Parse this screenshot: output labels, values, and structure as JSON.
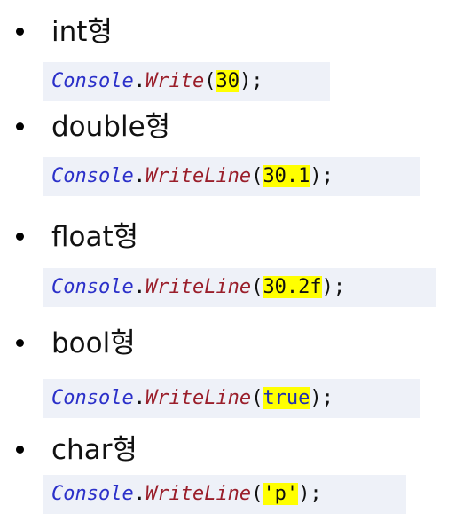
{
  "items": [
    {
      "type": "int형",
      "cls": "Console",
      "dot": ".",
      "method": "Write",
      "open": "(",
      "arg": "30",
      "close": ");"
    },
    {
      "type": "double형",
      "cls": "Console",
      "dot": ".",
      "method": "WriteLine",
      "open": "(",
      "arg": "30.1",
      "close": ");"
    },
    {
      "type": "float형",
      "cls": "Console",
      "dot": ".",
      "method": "WriteLine",
      "open": "(",
      "arg": "30.2f",
      "close": ");"
    },
    {
      "type": "bool형",
      "cls": "Console",
      "dot": ".",
      "method": "WriteLine",
      "open": "(",
      "arg": "true",
      "close": ");"
    },
    {
      "type": "char형",
      "cls": "Console",
      "dot": ".",
      "method": "WriteLine",
      "open": "(",
      "arg": "'p'",
      "close": ");"
    }
  ],
  "colors": {
    "class_name": "#2b30c9",
    "method_name": "#9a1e2a",
    "highlight": "#ffff00",
    "code_background": "#eef1f8"
  }
}
